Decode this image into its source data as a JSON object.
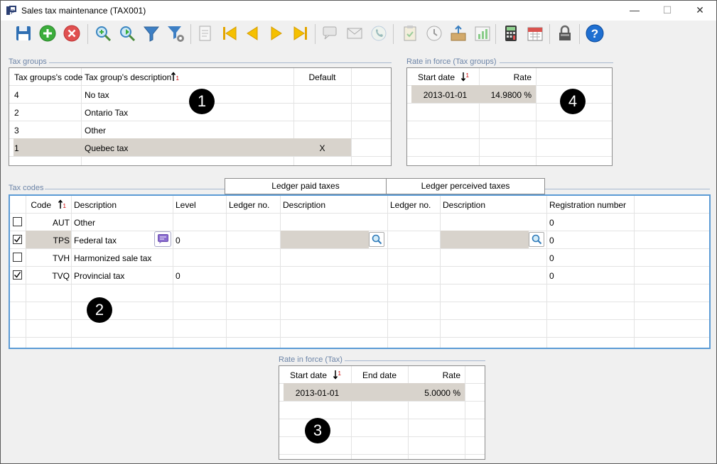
{
  "window": {
    "title": "Sales tax maintenance (TAX001)",
    "minimize": "—",
    "maximize": "☐",
    "close": "✕"
  },
  "groups": {
    "tax_groups": "Tax groups",
    "rate_groups": "Rate in force (Tax groups)",
    "tax_codes": "Tax codes",
    "rate_tax": "Rate in force (Tax)"
  },
  "tax_groups": {
    "headers": {
      "code": "Tax groups's code",
      "desc": "Tax group's description",
      "sort_icon": "sort-ascending-icon",
      "default": "Default"
    },
    "rows": [
      {
        "code": "4",
        "desc": "No tax",
        "default": ""
      },
      {
        "code": "2",
        "desc": "Ontario Tax",
        "default": ""
      },
      {
        "code": "3",
        "desc": "Other",
        "default": ""
      },
      {
        "code": "1",
        "desc": "Quebec tax",
        "default": "X"
      }
    ]
  },
  "rate_groups": {
    "headers": {
      "start": "Start date",
      "rate": "Rate"
    },
    "rows": [
      {
        "start": "2013-01-01",
        "rate": "14.9800 %"
      }
    ]
  },
  "tax_codes": {
    "super_headers": {
      "paid": "Ledger paid taxes",
      "perceived": "Ledger perceived taxes"
    },
    "headers": {
      "code": "Code",
      "desc": "Description",
      "level": "Level",
      "paid_ledger": "Ledger no.",
      "paid_desc": "Description",
      "perc_ledger": "Ledger no.",
      "perc_desc": "Description",
      "reg": "Registration number"
    },
    "rows": [
      {
        "checked": false,
        "code": "AUT",
        "desc": "Other",
        "level": "",
        "reg": "0"
      },
      {
        "checked": true,
        "code": "TPS",
        "desc": "Federal tax",
        "level": "0",
        "reg": "0"
      },
      {
        "checked": false,
        "code": "TVH",
        "desc": "Harmonized sale tax",
        "level": "",
        "reg": "0"
      },
      {
        "checked": true,
        "code": "TVQ",
        "desc": "Provincial tax",
        "level": "0",
        "reg": "0"
      }
    ]
  },
  "rate_tax": {
    "headers": {
      "start": "Start date",
      "end": "End date",
      "rate": "Rate"
    },
    "rows": [
      {
        "start": "2013-01-01",
        "end": "",
        "rate": "5.0000 %"
      }
    ]
  },
  "badges": {
    "b1": "1",
    "b2": "2",
    "b3": "3",
    "b4": "4"
  }
}
